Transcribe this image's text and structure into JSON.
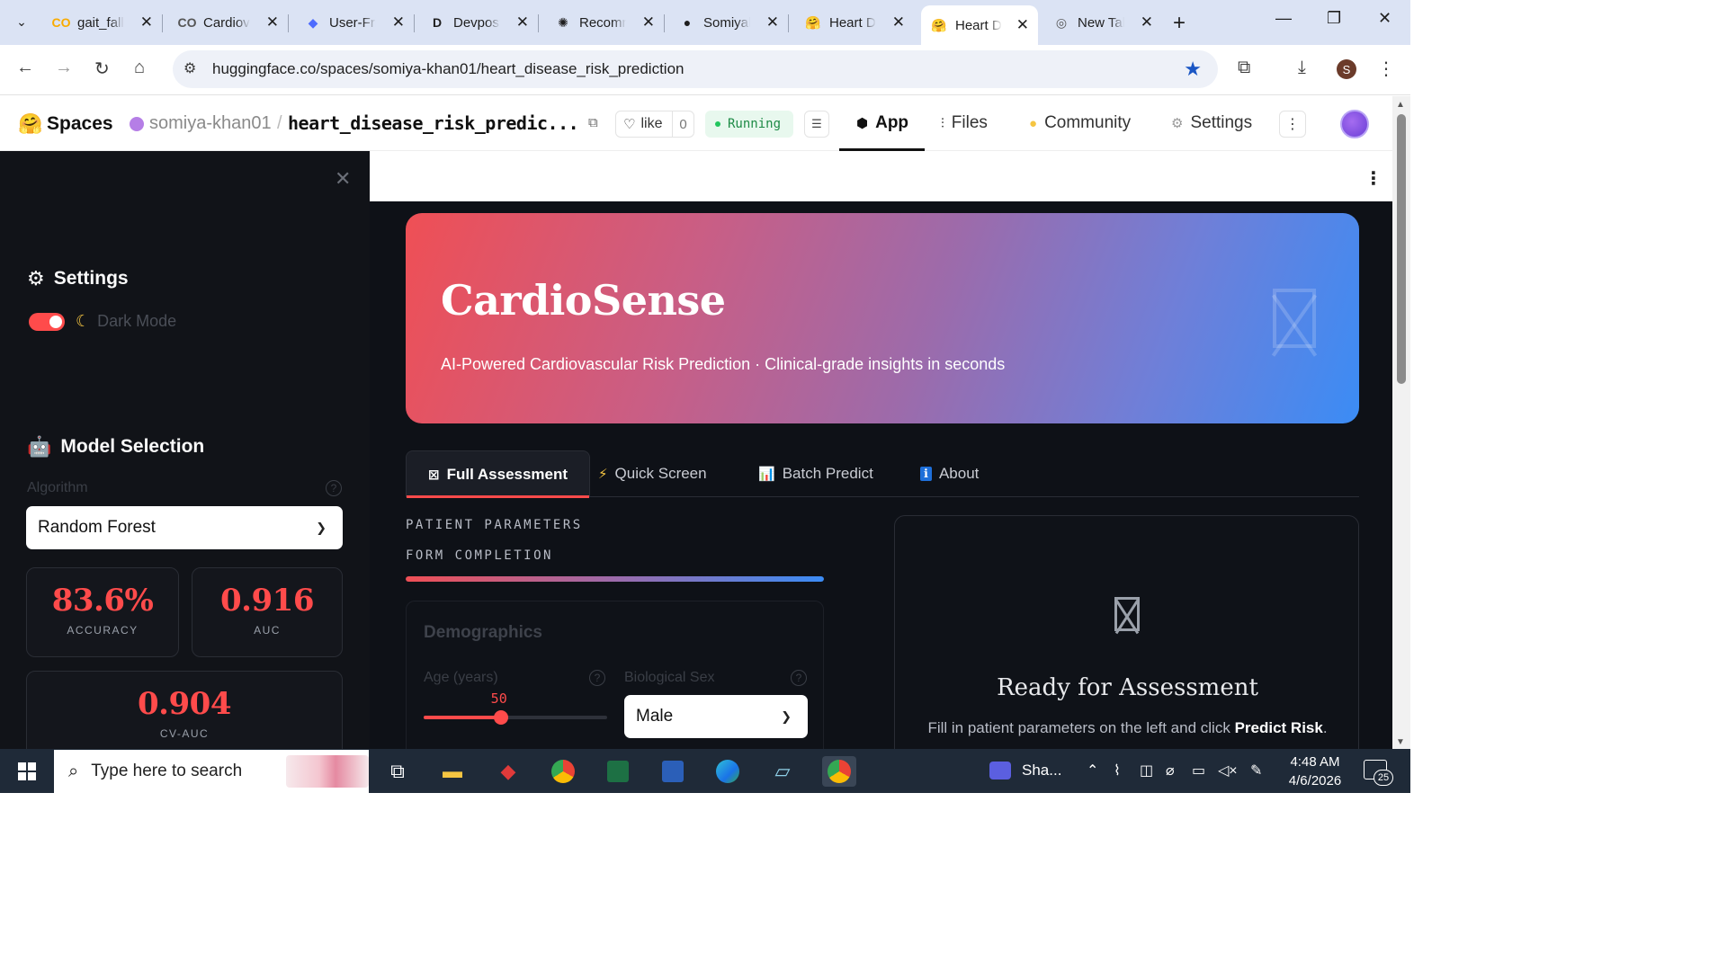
{
  "browser": {
    "tabs": [
      {
        "title": "gait_fall",
        "icon": "colab-icon",
        "favicon": "CO",
        "favcolor": "#f9ab00"
      },
      {
        "title": "Cardiov",
        "icon": "colab-icon",
        "favicon": "CO",
        "favcolor": "#555555"
      },
      {
        "title": "User-Fri",
        "icon": "deepseek-icon",
        "favicon": "◆",
        "favcolor": "#4d6bfe"
      },
      {
        "title": "Devpost",
        "icon": "devpost-icon",
        "favicon": "D",
        "favcolor": "#1f1f1f"
      },
      {
        "title": "Recomm",
        "icon": "chatgpt-icon",
        "favicon": "✺",
        "favcolor": "#1f1f1f"
      },
      {
        "title": "Somiyal",
        "icon": "github-icon",
        "favicon": "●",
        "favcolor": "#1f1f1f"
      },
      {
        "title": "Heart D",
        "icon": "huggingface-icon",
        "favicon": "🤗",
        "favcolor": "#f5c542"
      },
      {
        "title": "Heart D",
        "icon": "huggingface-icon",
        "favicon": "🤗",
        "favcolor": "#f5c542",
        "active": true
      },
      {
        "title": "New Tal",
        "icon": "chrome-icon",
        "favicon": "◎",
        "favcolor": "#555555"
      }
    ],
    "url": "huggingface.co/spaces/somiya-khan01/heart_disease_risk_prediction",
    "profile_initial": "S"
  },
  "hf": {
    "section": "Spaces",
    "owner": "somiya-khan01",
    "repo": "heart_disease_risk_predic...",
    "like_label": "like",
    "like_count": "0",
    "status": "Running",
    "nav": [
      {
        "label": "App",
        "icon": "cube-icon"
      },
      {
        "label": "Files",
        "icon": "files-icon"
      },
      {
        "label": "Community",
        "icon": "community-icon"
      },
      {
        "label": "Settings",
        "icon": "gear-icon"
      }
    ]
  },
  "sidebar": {
    "settings_title": "Settings",
    "dark_mode_label": "Dark Mode",
    "dark_mode_on": true,
    "model_title": "Model Selection",
    "algorithm_label": "Algorithm",
    "algorithm_value": "Random Forest",
    "metrics": [
      {
        "value": "83.6%",
        "label": "ACCURACY"
      },
      {
        "value": "0.916",
        "label": "AUC"
      },
      {
        "value": "0.904",
        "label": "CV-AUC"
      }
    ]
  },
  "hero": {
    "title": "CardioSense",
    "subtitle": "AI-Powered Cardiovascular Risk Prediction · Clinical-grade insights in seconds"
  },
  "tabs": [
    {
      "label": "Full Assessment",
      "icon": "⊠",
      "active": true
    },
    {
      "label": "Quick Screen",
      "icon": "⚡"
    },
    {
      "label": "Batch Predict",
      "icon": "📊"
    },
    {
      "label": "About",
      "icon": "ℹ"
    }
  ],
  "form": {
    "section_label": "PATIENT PARAMETERS",
    "progress_label": "FORM COMPLETION",
    "progress_fraction": 1.0,
    "card_title": "Demographics",
    "age_label": "Age (years)",
    "age_value": "50",
    "age_fraction": 0.42,
    "sex_label": "Biological Sex",
    "sex_value": "Male"
  },
  "result": {
    "title": "Ready for Assessment",
    "desc_prefix": "Fill in patient parameters on the left and click ",
    "desc_action": "Predict Risk",
    "desc_suffix": "."
  },
  "taskbar": {
    "search_placeholder": "Type here to search",
    "running_app": "Sha...",
    "time": "4:48 AM",
    "date": "4/6/2026",
    "notifications": "25"
  }
}
